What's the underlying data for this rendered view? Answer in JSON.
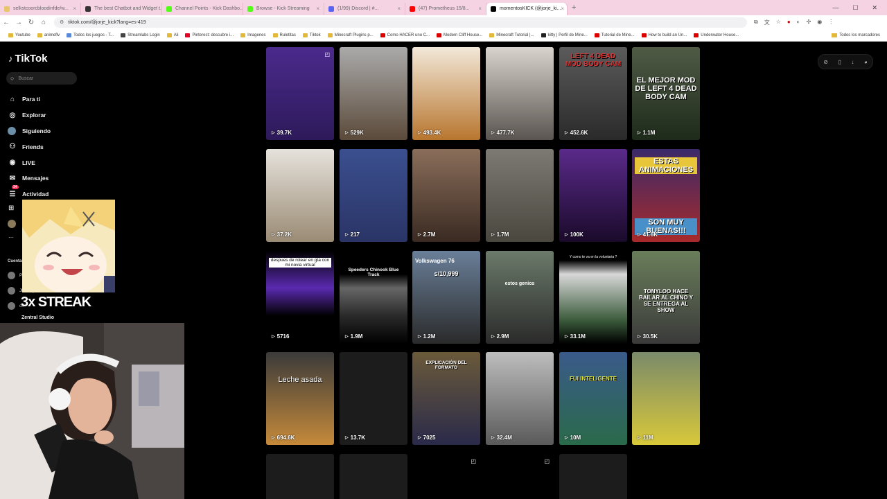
{
  "browser": {
    "tabs": [
      {
        "label": "selkstcoorcbloodinfde/w...",
        "color": "#e9c46a",
        "active": false
      },
      {
        "label": "The best Chatbot and Widget t...",
        "color": "#333333",
        "active": false
      },
      {
        "label": "Channel Points - Kick Dashbo...",
        "color": "#53fc18",
        "active": false
      },
      {
        "label": "Browse - Kick Streaming",
        "color": "#53fc18",
        "active": false
      },
      {
        "label": "(1/99) Discord | #...",
        "color": "#5865f2",
        "active": false
      },
      {
        "label": "(47) Prometheus 15/8...",
        "color": "#ff0000",
        "active": false
      },
      {
        "label": "momentosKICK (@jorje_ki...",
        "color": "#000000",
        "active": true
      }
    ],
    "url": "tiktok.com/@jorje_kick?lang=es-419",
    "bookmarks": [
      "Youtube",
      "animeflv",
      "Todos los juegos - T...",
      "Streamlabs Login",
      "Ali",
      "Pinterest: descubre i...",
      "Imagenes",
      "Ruletitas",
      "Tiktok",
      "Minecraft Plugins p...",
      "Como HACER uno C...",
      "Modern Cliff House...",
      "Minecraft Tutorial |...",
      "kitty | Perfil de Mine...",
      "Tutorial de Mine...",
      "How to build an Un...",
      "Underwater House..."
    ],
    "bookmarks_right": "Todos los marcadores"
  },
  "sidebar": {
    "logo": "TikTok",
    "search_placeholder": "Buscar",
    "nav": [
      {
        "label": "Para ti",
        "icon": "home-icon"
      },
      {
        "label": "Explorar",
        "icon": "compass-icon"
      },
      {
        "label": "Siguiendo",
        "icon": "following-avatar"
      },
      {
        "label": "Friends",
        "icon": "friends-icon"
      },
      {
        "label": "LIVE",
        "icon": "live-icon"
      },
      {
        "label": "Mensajes",
        "icon": "messages-icon"
      },
      {
        "label": "Actividad",
        "icon": "activity-icon",
        "badge": "34"
      }
    ],
    "accounts_heading": "Cuentas",
    "accounts": [
      "P... pa...",
      "Jhon... jhonsn...",
      "co..."
    ],
    "zentral": "Zentral Studio"
  },
  "overlay": {
    "streak": "3x STREAK"
  },
  "videos": [
    {
      "views": "39.7K",
      "pinned": true
    },
    {
      "views": "529K"
    },
    {
      "views": "493.4K"
    },
    {
      "views": "477.7K"
    },
    {
      "views": "452.6K",
      "caption": "LEFT 4 DEAD MOD BODY CAM"
    },
    {
      "views": "1.1M",
      "caption": "EL MEJOR MOD DE LEFT 4 DEAD BODY CAM"
    },
    {
      "views": "37.2K"
    },
    {
      "views": "217"
    },
    {
      "views": "2.7M"
    },
    {
      "views": "1.7M"
    },
    {
      "views": "100K"
    },
    {
      "views": "41.6K",
      "caption": "ESTAS ANIMACIONES",
      "caption2": "SON MUY BUENAS!!!"
    },
    {
      "views": "5716",
      "caption": "despues de rolear en gta con mi novia virtual"
    },
    {
      "views": "1.9M",
      "caption": "Speeders Chinook Blue Track"
    },
    {
      "views": "1.2M",
      "caption": "Volkswagen 76",
      "caption2": "s/10,999"
    },
    {
      "views": "2.9M",
      "caption": "estos genios"
    },
    {
      "views": "33.1M",
      "caption": "Y como te va en la voluntaria ?"
    },
    {
      "views": "30.5K",
      "caption": "TONYLOO HACE BAILAR AL CHINO Y SE ENTREGA AL SHOW"
    },
    {
      "views": "694.6K",
      "caption": "Leche asada"
    },
    {
      "views": "13.7K"
    },
    {
      "views": "7025",
      "caption": "EXPLICACIÓN DEL FORMATO"
    },
    {
      "views": "32.4M"
    },
    {
      "views": "10M",
      "caption": "FUI INTELIGENTE"
    },
    {
      "views": "11M"
    }
  ]
}
